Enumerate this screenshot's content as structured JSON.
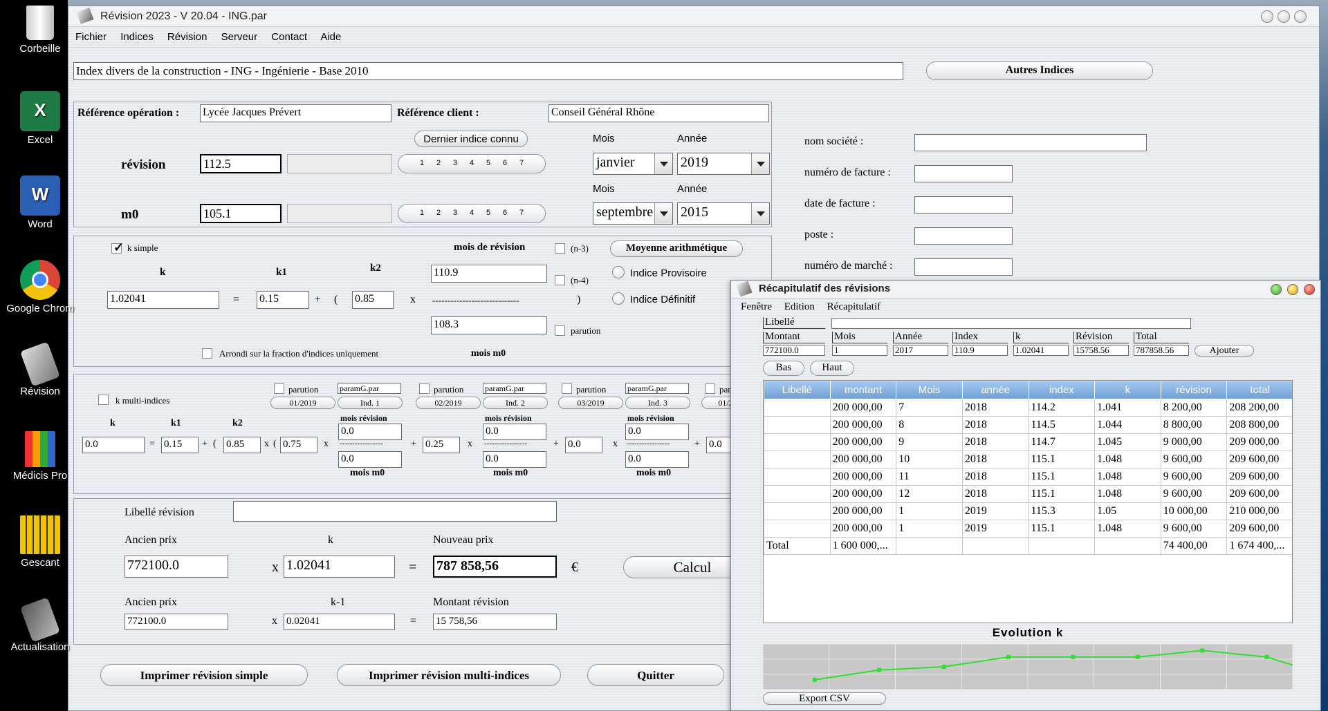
{
  "desktop": {
    "icons": [
      {
        "label": "Corbeille"
      },
      {
        "label": "Excel"
      },
      {
        "label": "Word"
      },
      {
        "label": "Google Chrom"
      },
      {
        "label": "Révision"
      },
      {
        "label": "Médicis Pro"
      },
      {
        "label": "Gescant"
      },
      {
        "label": "Actualisation"
      }
    ]
  },
  "window": {
    "title": "Révision 2023 - V 20.04 - ING.par",
    "menu": [
      "Fichier",
      "Indices",
      "Révision",
      "Serveur",
      "Contact",
      "Aide"
    ]
  },
  "index_title": "Index divers de la construction - ING - Ingénierie - Base 2010",
  "autres_indices": "Autres Indices",
  "ref": {
    "op_label": "Référence opération :",
    "op_value": "Lycée Jacques Prévert",
    "client_label": "Référence client :",
    "client_value": "Conseil Général Rhône"
  },
  "dernier_indice": "Dernier indice connu",
  "revision": {
    "label": "révision",
    "value": "112.5",
    "mois_label": "Mois",
    "annee_label": "Année",
    "mois": "janvier",
    "annee": "2019"
  },
  "m0": {
    "label": "m0",
    "value": "105.1",
    "mois_label": "Mois",
    "annee_label": "Année",
    "mois": "septembre",
    "annee": "2015"
  },
  "seg_digits": [
    "1",
    "2",
    "3",
    "4",
    "5",
    "6",
    "7"
  ],
  "simple": {
    "k_simple": "k simple",
    "mois_revision": "mois de révision",
    "n3": "(n-3)",
    "n4": "(n-4)",
    "moyenne": "Moyenne arithmétique",
    "provisoire": "Indice Provisoire",
    "definitif": "Indice Définitif",
    "k_label": "k",
    "k1_label": "k1",
    "k2_label": "k2",
    "k": "1.02041",
    "eq": "=",
    "k1": "0.15",
    "plus": "+",
    "paren_open": "(",
    "k2": "0.85",
    "x": "x",
    "dashes": "-----------------------------",
    "paren_close": ")",
    "index_rev": "110.9",
    "index_m0": "108.3",
    "parution": "parution",
    "arrondi": "Arrondi sur la fraction d'indices uniquement",
    "mois_m0": "mois m0"
  },
  "multi": {
    "k_multi": "k multi-indices",
    "k_label": "k",
    "k1_label": "k1",
    "k2_label": "k2",
    "k": "0.0",
    "k1": "0.15",
    "k2": "0.85",
    "c1": "0.75",
    "c2": "0.25",
    "c3": "0.0",
    "c4": "0.0",
    "groups": [
      {
        "parution": "parution",
        "param": "paramG.par",
        "date": "01/2019",
        "ind": "Ind. 1",
        "rev": "0.0",
        "m0": "0.0"
      },
      {
        "parution": "parution",
        "param": "paramG.par",
        "date": "02/2019",
        "ind": "Ind. 2",
        "rev": "0.0",
        "m0": "0.0"
      },
      {
        "parution": "parution",
        "param": "paramG.par",
        "date": "03/2019",
        "ind": "Ind. 3",
        "rev": "0.0",
        "m0": "0.0"
      }
    ],
    "par_cut": "par",
    "date_cut": "01/2",
    "mois_revision": "mois révision",
    "mois_m0": "mois m0",
    "dashes": "-----------------"
  },
  "calc": {
    "libelle_label": "Libellé révision",
    "libelle_value": "",
    "ancien_label": "Ancien prix",
    "k_label": "k",
    "nouveau_label": "Nouveau prix",
    "ancien": "772100.0",
    "k": "1.02041",
    "nouveau": "787 858,56",
    "euro": "€",
    "calcul": "Calcul",
    "ancien2_label": "Ancien prix",
    "km1_label": "k-1",
    "montant_label": "Montant révision",
    "ancien2": "772100.0",
    "km1": "0.02041",
    "montant": "15 758,56",
    "x": "x",
    "eq": "="
  },
  "buttons": {
    "imprimer_simple": "Imprimer révision simple",
    "imprimer_multi": "Imprimer révision multi-indices",
    "quitter": "Quitter"
  },
  "facture": {
    "societe": "nom société :",
    "numero": "numéro de facture :",
    "date": "date de facture :",
    "poste": "poste :",
    "marche": "numéro de marché :"
  },
  "recap": {
    "title": "Récapitulatif des révisions",
    "menu": [
      "Fenêtre",
      "Edition",
      "Récapitulatif"
    ],
    "libelle_label": "Libellé",
    "headers": [
      "Montant",
      "Mois",
      "Année",
      "Index",
      "k",
      "Révision",
      "Total"
    ],
    "entry": [
      "772100.0",
      "1",
      "2017",
      "110.9",
      "1.02041",
      "15758.56",
      "787858.56"
    ],
    "ajouter": "Ajouter",
    "bas": "Bas",
    "haut": "Haut",
    "columns": [
      "Libellé",
      "montant",
      "Mois",
      "année",
      "index",
      "k",
      "révision",
      "total"
    ],
    "rows": [
      [
        "",
        "200 000,00",
        "7",
        "2018",
        "114.2",
        "1.041",
        "8 200,00",
        "208 200,00"
      ],
      [
        "",
        "200 000,00",
        "8",
        "2018",
        "114.5",
        "1.044",
        "8 800,00",
        "208 800,00"
      ],
      [
        "",
        "200 000,00",
        "9",
        "2018",
        "114.7",
        "1.045",
        "9 000,00",
        "209 000,00"
      ],
      [
        "",
        "200 000,00",
        "10",
        "2018",
        "115.1",
        "1.048",
        "9 600,00",
        "209 600,00"
      ],
      [
        "",
        "200 000,00",
        "11",
        "2018",
        "115.1",
        "1.048",
        "9 600,00",
        "209 600,00"
      ],
      [
        "",
        "200 000,00",
        "12",
        "2018",
        "115.1",
        "1.048",
        "9 600,00",
        "209 600,00"
      ],
      [
        "",
        "200 000,00",
        "1",
        "2019",
        "115.3",
        "1.05",
        "10 000,00",
        "210 000,00"
      ],
      [
        "",
        "200 000,00",
        "1",
        "2019",
        "115.1",
        "1.048",
        "9 600,00",
        "209 600,00"
      ],
      [
        "Total",
        "1 600 000,...",
        "",
        "",
        "",
        "",
        "74 400,00",
        "1 674 400,..."
      ]
    ],
    "export": "Export CSV"
  },
  "chart_data": {
    "type": "line",
    "title": "Evolution k",
    "x": [
      1,
      2,
      3,
      4,
      5,
      6,
      7,
      8
    ],
    "values": [
      1.041,
      1.044,
      1.045,
      1.048,
      1.048,
      1.048,
      1.05,
      1.048
    ],
    "ylim": [
      1.038,
      1.052
    ],
    "grid": true,
    "color": "#33dd33"
  }
}
